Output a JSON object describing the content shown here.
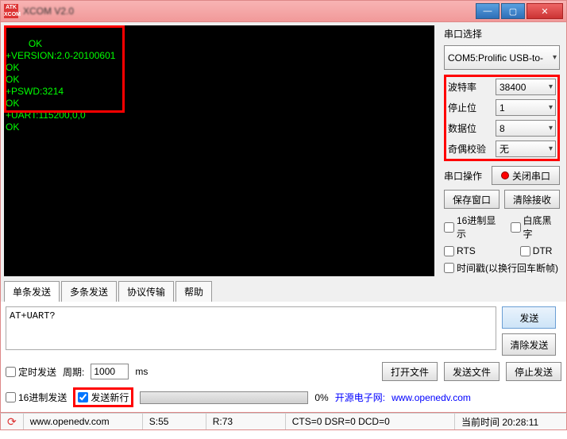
{
  "window": {
    "title": "XCOM V2.0",
    "logo": "ATK XCOM"
  },
  "terminal": {
    "lines": "OK\n+VERSION:2.0-20100601\nOK\nOK\n+PSWD:3214\nOK\n+UART:115200,0,0\nOK"
  },
  "side": {
    "port_label": "串口选择",
    "port_value": "COM5:Prolific USB-to-",
    "baud_label": "波特率",
    "baud_value": "38400",
    "stop_label": "停止位",
    "stop_value": "1",
    "data_label": "数据位",
    "data_value": "8",
    "parity_label": "奇偶校验",
    "parity_value": "无",
    "op_label": "串口操作",
    "close_port": "关闭串口",
    "save_window": "保存窗口",
    "clear_recv": "清除接收",
    "hex_display": "16进制显示",
    "white_bg": "白底黑字",
    "rts": "RTS",
    "dtr": "DTR",
    "timestamp": "时间戳(以换行回车断帧)"
  },
  "tabs": [
    "单条发送",
    "多条发送",
    "协议传输",
    "帮助"
  ],
  "send": {
    "input": "AT+UART?",
    "send_btn": "发送",
    "clear_btn": "清除发送"
  },
  "ctrl": {
    "timed_send": "定时发送",
    "period_label": "周期:",
    "period_value": "1000",
    "period_unit": "ms",
    "open_file": "打开文件",
    "send_file": "发送文件",
    "stop_send": "停止发送",
    "hex_send": "16进制发送",
    "newline_send": "发送新行",
    "progress_pct": "0%",
    "link_label": "开源电子网:",
    "link_url": "www.openedv.com"
  },
  "status": {
    "url": "www.openedv.com",
    "s": "S:55",
    "r": "R:73",
    "line": "CTS=0 DSR=0 DCD=0",
    "time": "当前时间 20:28:11"
  }
}
